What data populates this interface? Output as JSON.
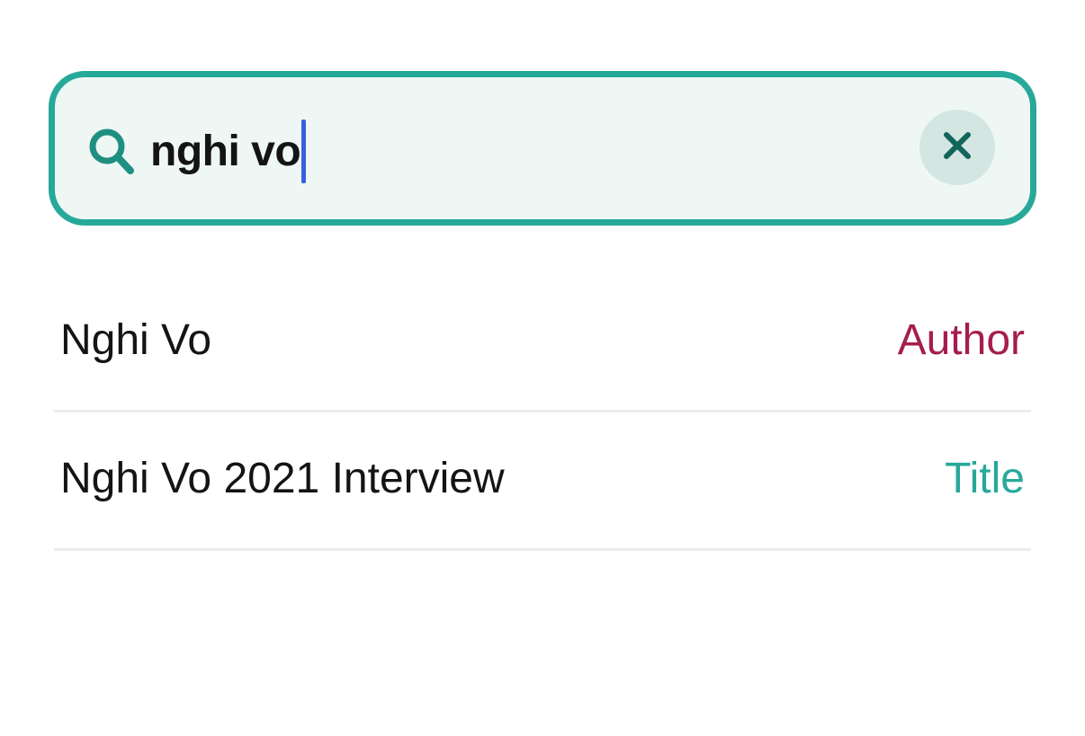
{
  "colors": {
    "accent": "#27a99a",
    "search_background": "#eff7f5",
    "clear_button_background": "#d3e6e2",
    "caret": "#3b5fe0",
    "author": "#a51d4f",
    "title": "#27a99a"
  },
  "search": {
    "icon": "search-icon",
    "query": "nghi vo",
    "clear_icon": "close-icon"
  },
  "results": [
    {
      "name": "Nghi Vo",
      "type": "Author",
      "type_color": "#a51d4f"
    },
    {
      "name": "Nghi Vo 2021 Interview",
      "type": "Title",
      "type_color": "#27a99a"
    }
  ]
}
